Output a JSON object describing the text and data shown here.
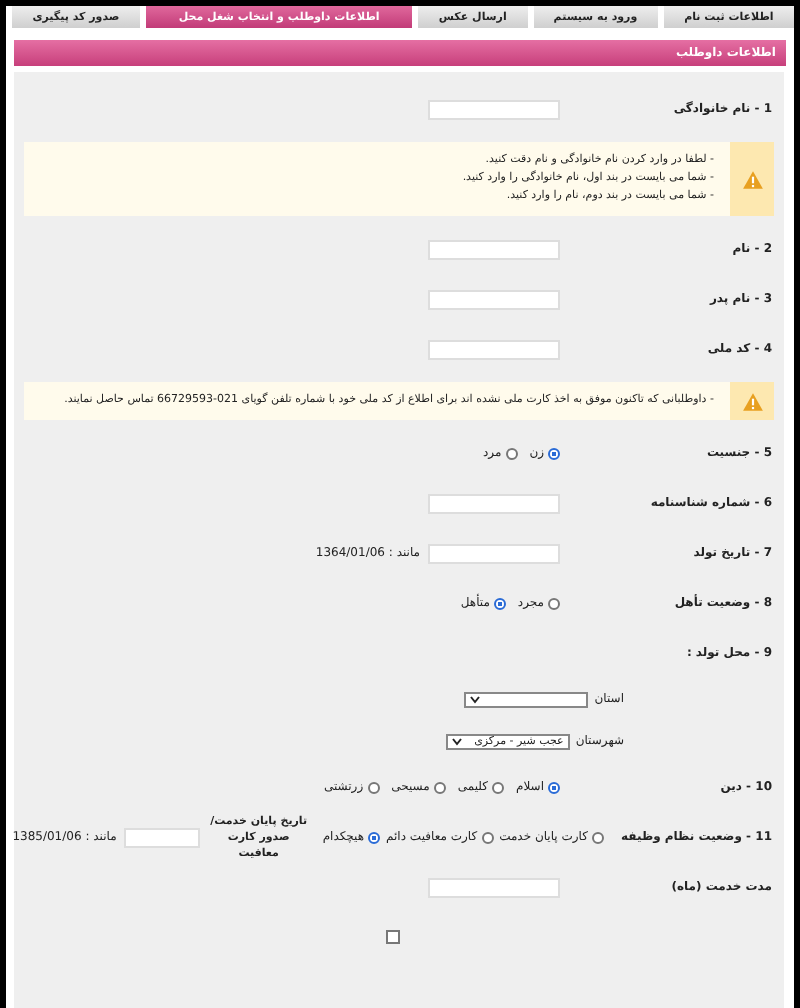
{
  "tabs": [
    {
      "label": "اطلاعات ثبت نام",
      "selected": false
    },
    {
      "label": "ورود به سیستم",
      "selected": false
    },
    {
      "label": "ارسال عکس",
      "selected": false
    },
    {
      "label": "اطلاعات داوطلب و انتخاب شغل محل",
      "selected": true
    },
    {
      "label": "صدور کد پیگیری",
      "selected": false
    }
  ],
  "panel": {
    "title": "اطلاعات داوطلب"
  },
  "form": {
    "items": [
      {
        "kind": "field",
        "label": "1 - نام خانوادگی"
      },
      {
        "kind": "notice",
        "lines": [
          "- لطفا در وارد کردن نام خانوادگی و نام دقت کنید.",
          "- شما می بایست در بند اول، نام خانوادگی را وارد کنید.",
          "- شما می بایست در بند دوم، نام را وارد کنید."
        ]
      },
      {
        "kind": "field",
        "label": "2 - نام"
      },
      {
        "kind": "field",
        "label": "3 - نام پدر"
      },
      {
        "kind": "field",
        "label": "4 - کد ملی"
      },
      {
        "kind": "notice",
        "lines": [
          "- داوطلبانی که تاکنون موفق به اخذ کارت ملی نشده اند برای اطلاع از کد ملی خود با شماره تلفن گویای 021-66729593 تماس حاصل نمایند."
        ]
      },
      {
        "kind": "radio",
        "label": "5 - جنسیت",
        "options": [
          {
            "label": "زن",
            "selected": true
          },
          {
            "label": "مرد",
            "selected": false
          }
        ]
      },
      {
        "kind": "field",
        "label": "6 - شماره شناسنامه"
      },
      {
        "kind": "field",
        "label": "7 - تاریخ تولد",
        "hint": "مانند : 1364/01/06"
      },
      {
        "kind": "radio",
        "label": "8 - وضعیت تأهل",
        "options": [
          {
            "label": "مجرد",
            "selected": false
          },
          {
            "label": "متأهل",
            "selected": true
          }
        ]
      },
      {
        "kind": "heading",
        "label": "9 - محل تولد :"
      },
      {
        "kind": "select",
        "label": "استان"
      },
      {
        "kind": "select",
        "label": "شهرستان",
        "value": "عجب شیر - مرکزی"
      },
      {
        "kind": "radio",
        "label": "10 - دین",
        "options": [
          {
            "label": "اسلام",
            "selected": true
          },
          {
            "label": "کلیمی",
            "selected": false
          },
          {
            "label": "مسیحی",
            "selected": false
          },
          {
            "label": "زرتشتی",
            "selected": false
          }
        ]
      },
      {
        "kind": "radio",
        "label": "11 - وضعیت نظام وظیفه",
        "options": [
          {
            "label": "کارت پایان خدمت",
            "selected": false
          },
          {
            "label": "کارت معافیت دائم",
            "selected": false
          },
          {
            "label": "هیچکدام",
            "selected": true
          }
        ],
        "extra": {
          "label": "تاریخ پایان خدمت/صدور کارت معافیت",
          "hint": "مانند : 1385/01/06"
        }
      },
      {
        "kind": "field",
        "label": "مدت خدمت (ماه)"
      },
      {
        "kind": "checkbox",
        "checked": false
      }
    ]
  }
}
